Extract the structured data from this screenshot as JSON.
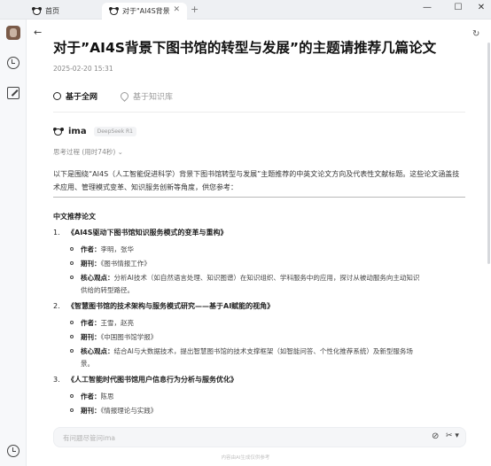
{
  "tabs": [
    {
      "label": "首页"
    },
    {
      "label": "对于\"AI4S背景"
    }
  ],
  "window_controls": {
    "minimize": "—",
    "maximize": "☐",
    "close": "✕"
  },
  "nav": {
    "back": "←",
    "refresh": "↻"
  },
  "title": "对于”AI4S背景下图书馆的转型与发展”的主题请推荐几篇论文",
  "date": "2025-02-20 15:31",
  "sources": [
    {
      "label": "基于全网",
      "active": true
    },
    {
      "label": "基于知识库",
      "active": false
    }
  ],
  "assistant": {
    "name": "ima",
    "model": "DeepSeek R1",
    "thinking": "思考过程 (用时74秒) ⌄"
  },
  "intro": "以下是围绕“AI4S（人工智能促进科学）背景下图书馆转型与发展”主题推荐的中英文论文方向及代表性文献标题。这些论文涵盖技术应用、管理模式变革、知识服务创新等角度，供您参考：",
  "section_title": "中文推荐论文",
  "papers": [
    {
      "num": "1.",
      "title": "《AI4S驱动下图书馆知识服务模式的变革与重构》",
      "author_label": "作者：",
      "author": "李明，张华",
      "journal_label": "期刊：",
      "journal": "《图书情报工作》",
      "view_label": "核心观点：",
      "view_1": "分析AI技术（如自然语言处理、知识图谱）在知识组织、学科服务中的应用，探讨从被动服务向主动知识",
      "view_2": "供给的转型路径。"
    },
    {
      "num": "2.",
      "title": "《智慧图书馆的技术架构与服务模式研究——基于AI赋能的视角》",
      "author_label": "作者：",
      "author": "王雪，赵亮",
      "journal_label": "期刊：",
      "journal": "《中国图书馆学报》",
      "view_label": "核心观点：",
      "view_1": "结合AI与大数据技术，提出智慧图书馆的技术支撑框架（如智能问答、个性化推荐系统）及新型服务场",
      "view_2": "景。"
    },
    {
      "num": "3.",
      "title": "《人工智能时代图书馆用户信息行为分析与服务优化》",
      "author_label": "作者：",
      "author": "陈思",
      "journal_label": "期刊：",
      "journal": "《情报理论与实践》"
    }
  ],
  "input": {
    "placeholder": "有问题尽管问ima"
  },
  "footer": "内容由AI生成仅供参考"
}
